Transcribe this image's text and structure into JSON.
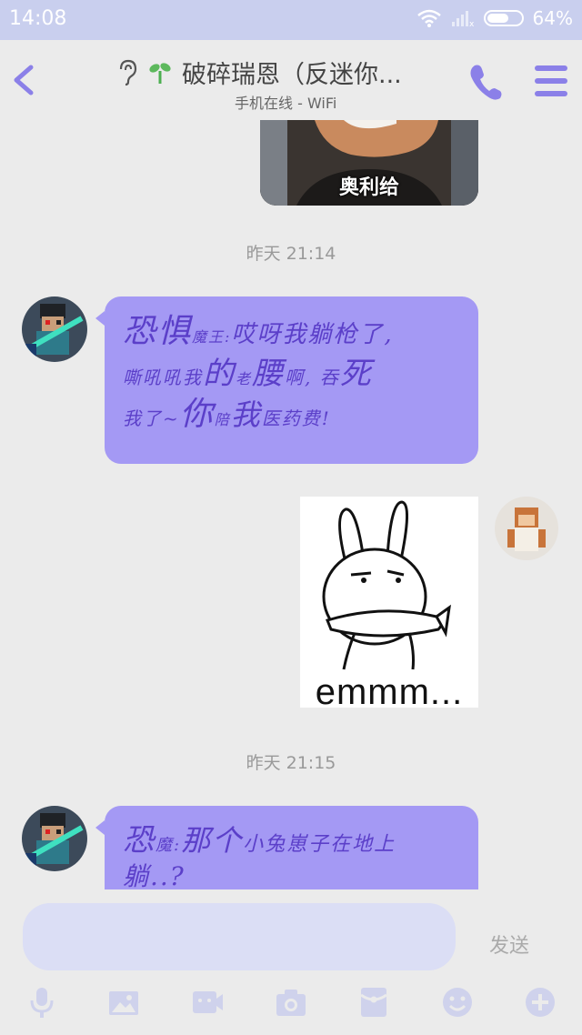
{
  "status": {
    "time": "14:08",
    "battery": "64%",
    "battery_level": 0.64
  },
  "header": {
    "title": "破碎瑞恩（反迷你...",
    "subtitle": "手机在线 - WiFi"
  },
  "messages": {
    "image_caption": "奥利给",
    "ts1": "昨天 21:14",
    "msg1": {
      "line1_a": "恐惧",
      "line1_b": "魔王:",
      "line1_c": "哎呀我躺枪了,",
      "line2_a": "嘶吼吼我",
      "line2_b": "的",
      "line2_c": "老",
      "line2_d": "腰",
      "line2_e": "啊, 吞",
      "line2_f": "死",
      "line3_a": "我了~",
      "line3_b": "你",
      "line3_c": "陪",
      "line3_d": "我",
      "line3_e": "医药费!"
    },
    "sticker_text": "emmm...",
    "ts2": "昨天 21:15",
    "msg2": {
      "line1_a": "恐",
      "line1_b": "魔:",
      "line1_c": "那个",
      "line1_d": "小兔崽子在地上",
      "line2": "躺..?"
    }
  },
  "input": {
    "send_label": "发送"
  },
  "colors": {
    "accent": "#8b80e8",
    "bubble": "#a499f4",
    "bubble_text": "#5b3fc9",
    "statusbar": "#c9cfee"
  }
}
